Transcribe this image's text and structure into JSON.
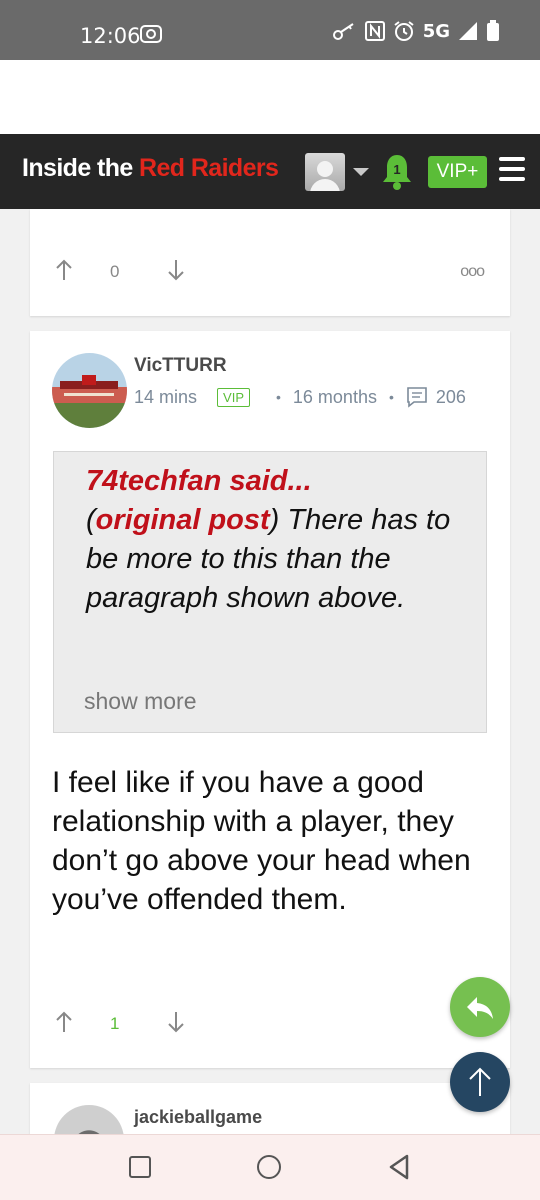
{
  "status_bar": {
    "time": "12:06",
    "network": "5G"
  },
  "header": {
    "logo_white": "Inside the ",
    "logo_red": "Red Raiders",
    "notification_count": "1",
    "vip_label": "VIP+"
  },
  "post_prev": {
    "vote_count": "0",
    "more_label": "ooo"
  },
  "post": {
    "username": "VicTTURR",
    "time_ago": "14 mins",
    "vip_tag": "VIP",
    "member_since": "16 months",
    "post_count": "206",
    "quote": {
      "author": "74techfan said...",
      "link_open": "(",
      "link": "original post",
      "link_close": ")",
      "text": " There has to be more to this than the paragraph shown above.",
      "show_more": "show more"
    },
    "body": "I feel like if you have a good relationship with a player, they don’t go above your head when you’ve offended them.",
    "vote_count": "1"
  },
  "post_next": {
    "username": "jackieballgame"
  },
  "colors": {
    "accent_red": "#e1261c",
    "vip_green": "#5bbd38",
    "quote_red": "#c0101a",
    "header_bg": "#262626",
    "scroll_top": "#254662"
  }
}
